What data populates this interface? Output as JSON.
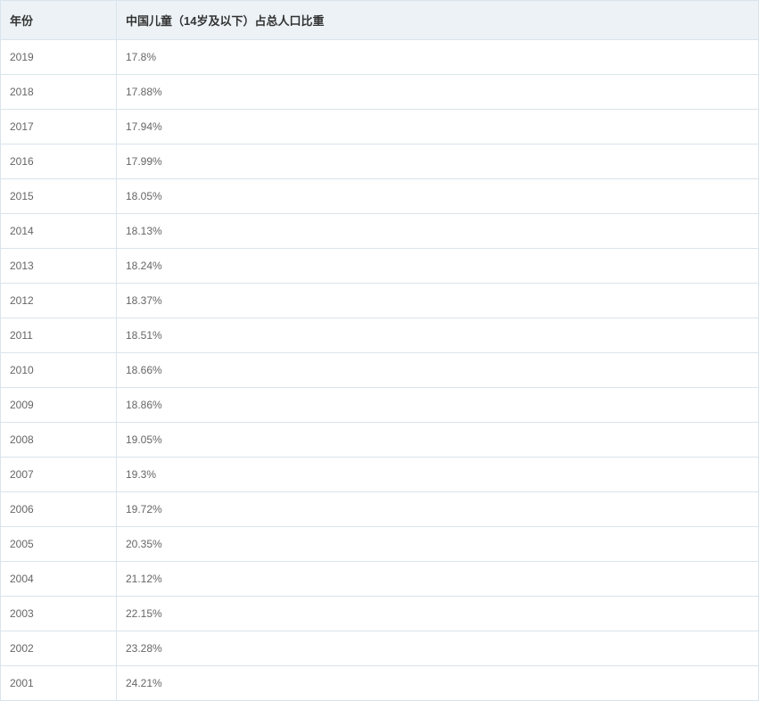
{
  "table": {
    "headers": {
      "year": "年份",
      "value": "中国儿童（14岁及以下）占总人口比重"
    },
    "rows": [
      {
        "year": "2019",
        "value": "17.8%"
      },
      {
        "year": "2018",
        "value": "17.88%"
      },
      {
        "year": "2017",
        "value": "17.94%"
      },
      {
        "year": "2016",
        "value": "17.99%"
      },
      {
        "year": "2015",
        "value": "18.05%"
      },
      {
        "year": "2014",
        "value": "18.13%"
      },
      {
        "year": "2013",
        "value": "18.24%"
      },
      {
        "year": "2012",
        "value": "18.37%"
      },
      {
        "year": "2011",
        "value": "18.51%"
      },
      {
        "year": "2010",
        "value": "18.66%"
      },
      {
        "year": "2009",
        "value": "18.86%"
      },
      {
        "year": "2008",
        "value": "19.05%"
      },
      {
        "year": "2007",
        "value": "19.3%"
      },
      {
        "year": "2006",
        "value": "19.72%"
      },
      {
        "year": "2005",
        "value": "20.35%"
      },
      {
        "year": "2004",
        "value": "21.12%"
      },
      {
        "year": "2003",
        "value": "22.15%"
      },
      {
        "year": "2002",
        "value": "23.28%"
      },
      {
        "year": "2001",
        "value": "24.21%"
      }
    ]
  }
}
